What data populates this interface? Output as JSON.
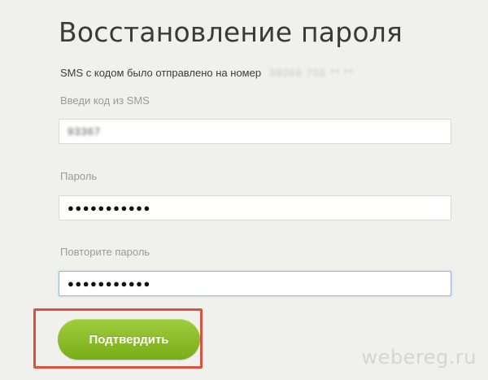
{
  "page": {
    "title": "Восстановление пароля",
    "sms_notice": "SMS с кодом было отправлено на номер",
    "masked_phone": "38066 756 ** **"
  },
  "form": {
    "code_label": "Введи код из SMS",
    "code_value": "93367",
    "password_label": "Пароль",
    "password_value": "●●●●●●●●●●●",
    "repeat_label": "Повторите пароль",
    "repeat_value": "●●●●●●●●●●●",
    "submit_label": "Подтвердить"
  },
  "watermark": "webereg.ru",
  "colors": {
    "background": "#f0f0ec",
    "button": "#8ec02a",
    "highlight": "#d9533f"
  }
}
